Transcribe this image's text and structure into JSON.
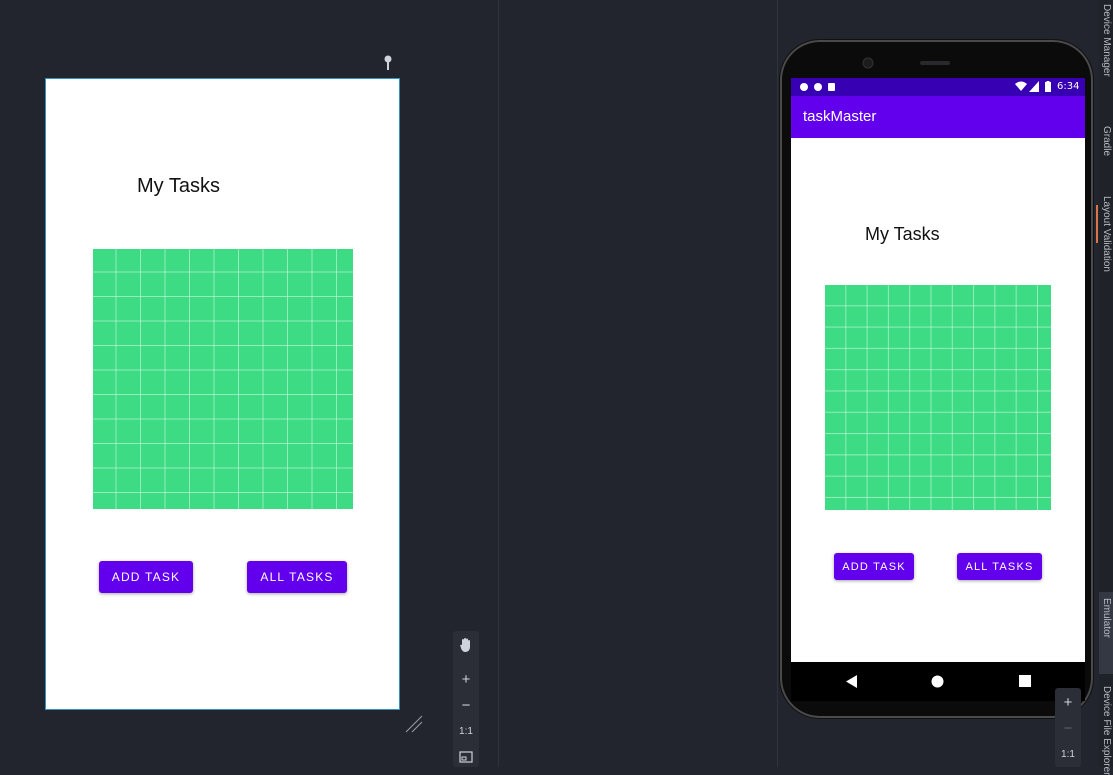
{
  "design": {
    "title": "My Tasks",
    "add_task": "Add Task",
    "all_tasks": "All Tasks"
  },
  "phone": {
    "time": "6:34",
    "app_title": "taskMaster",
    "title": "My Tasks",
    "add_task": "Add Task",
    "all_tasks": "All Tasks"
  },
  "zoom": {
    "plus": "+",
    "minus": "−",
    "reset": "1:1"
  },
  "tool_windows": [
    {
      "label": "Device Manager"
    },
    {
      "label": "Gradle"
    },
    {
      "label": "Layout Validation"
    },
    {
      "label": "Emulator"
    },
    {
      "label": "Device File Explorer"
    }
  ],
  "colors": {
    "primary": "#6200ee",
    "primary_dark": "#3700b3",
    "image_green": "#3ddc84",
    "background": "#22252d"
  },
  "icons": [
    "pin-icon",
    "pan-hand-icon",
    "fit-screen-icon",
    "resize-handle-icon",
    "back-icon",
    "home-icon",
    "recents-icon",
    "wifi-icon",
    "signal-icon",
    "battery-icon"
  ]
}
